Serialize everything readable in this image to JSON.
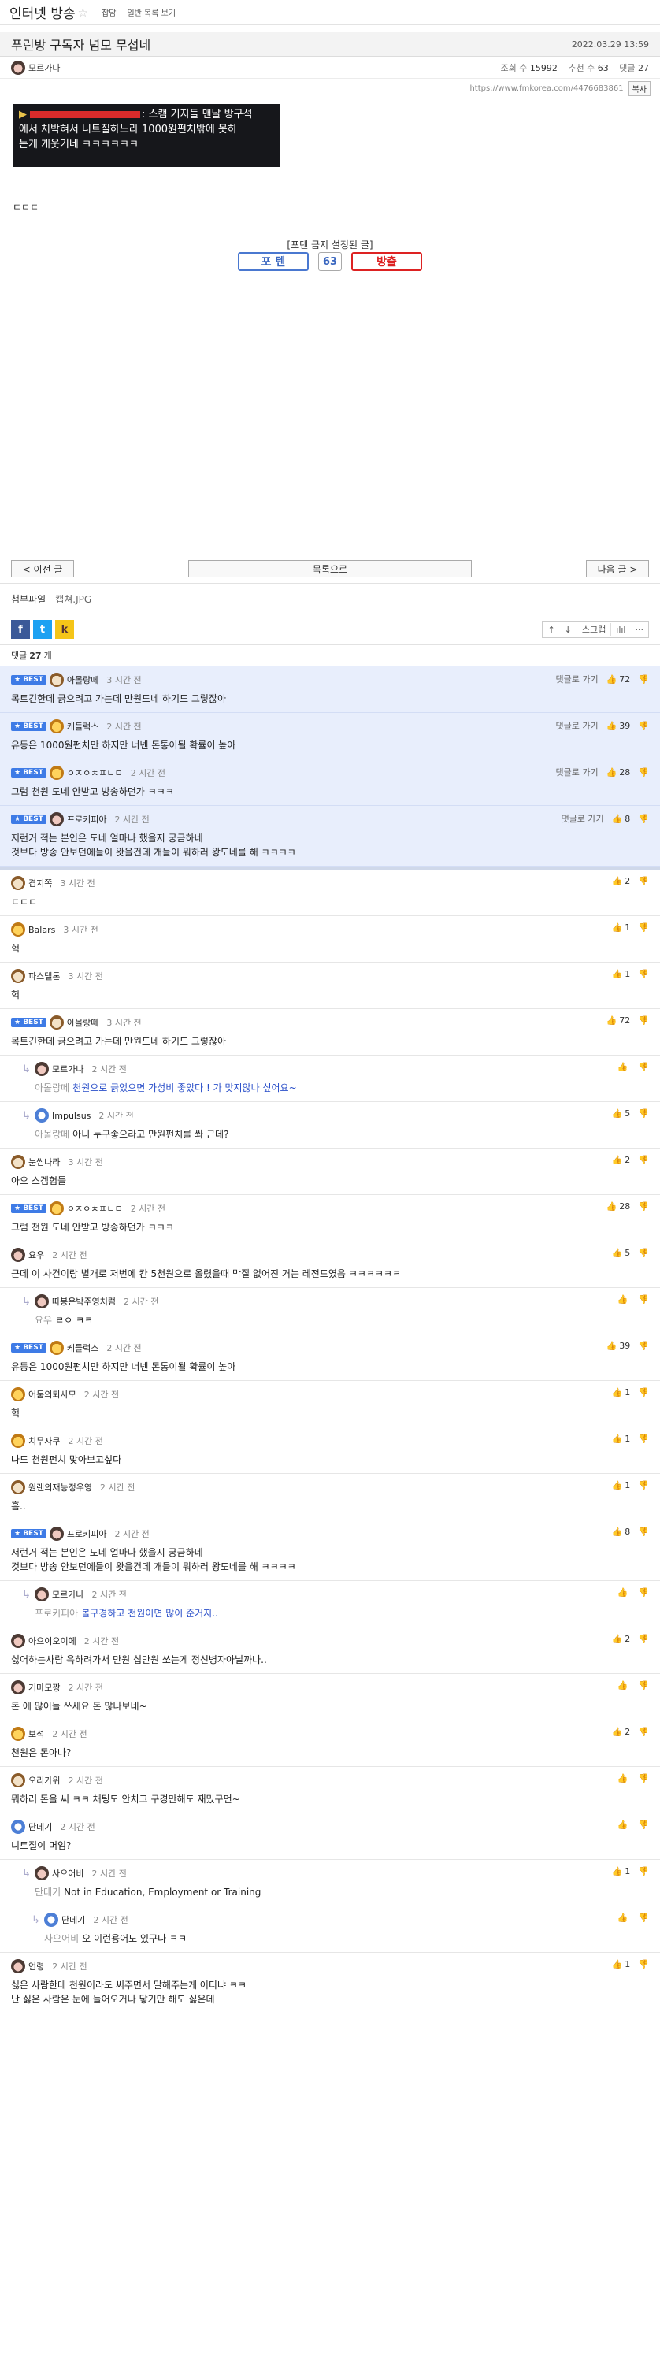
{
  "board": {
    "title": "인터넷 방송",
    "star": "☆",
    "links": [
      "잡담",
      "일반 목록 보기"
    ]
  },
  "post": {
    "title": "푸린방 구독자 념모 무섭네",
    "date": "2022.03.29 13:59",
    "author": "모르가나",
    "views_label": "조회 수",
    "views": "15992",
    "likes_label": "추천 수",
    "likes": "63",
    "comments_label": "댓글",
    "comments": "27",
    "url": "https://www.fmkorea.com/4476683861",
    "copy_label": "복사",
    "capture_line1_tail": ": 스캠 거지들 맨날 방구석",
    "capture_line2": "에서 처박혀서 니트질하느라 1000원펀치밖에 못하",
    "capture_line3": "는게 개웃기네 ㅋㅋㅋㅋㅋㅋ",
    "body": "ㄷㄷㄷ",
    "notice": "[포텐 금지 설정된 글]",
    "vote_up": "포 텐",
    "vote_count": "63",
    "vote_down": "방출"
  },
  "nav": {
    "prev": "< 이전 글",
    "list": "목록으로",
    "next": "다음 글 >"
  },
  "attach": {
    "label": "첨부파일",
    "file": "캡쳐.JPG"
  },
  "tools": {
    "fb": "f",
    "tw": "t",
    "kakao": "k",
    "up": "↑",
    "down": "↓",
    "scrap": "스크랩",
    "chart": "ılıl",
    "more": "···"
  },
  "comment_count": {
    "prefix": "댓글",
    "count": "27",
    "suffix": "개"
  },
  "ui": {
    "reply": "댓글로 가기",
    "thumb": "👍",
    "downvote": "👎",
    "best": "BEST",
    "reply_arrow": "↳"
  },
  "best_comments": [
    {
      "name": "아몰랑떼",
      "time": "3 시간 전",
      "up": "72",
      "text": "목트긴한데 긁으려고 가는데 만원도네 하기도 그렇잖아",
      "av": "dog"
    },
    {
      "name": "케들럭스",
      "time": "2 시간 전",
      "up": "39",
      "text": "유동은 1000원펀치만 하지만 너넨 돈통이될 확률이 높아",
      "av": "cat"
    },
    {
      "name": "ㅇㅈㅇㅊㅍㄴㅁ",
      "time": "2 시간 전",
      "up": "28",
      "text": "그럼 천원 도네 안받고 방송하던가 ㅋㅋㅋ",
      "av": "cat"
    },
    {
      "name": "프로키피아",
      "time": "2 시간 전",
      "up": "8",
      "text": "저런거 적는 본인은 도네 얼마나 했을지 궁금하네",
      "text2": "것보다 방송 안보던에들이 왓을건데 개들이 뭐하러 왕도네를 해 ㅋㅋㅋㅋ",
      "av": "bear"
    }
  ],
  "comments": [
    {
      "name": "겹지쪽",
      "time": "3 시간 전",
      "up": "2",
      "text": "ㄷㄷㄷ",
      "av": "dog"
    },
    {
      "name": "Balars",
      "time": "3 시간 전",
      "up": "1",
      "text": "헉",
      "av": "cat"
    },
    {
      "name": "파스텔톤",
      "time": "3 시간 전",
      "up": "1",
      "text": "헉",
      "av": "dog"
    },
    {
      "name": "아몰랑떼",
      "time": "3 시간 전",
      "up": "72",
      "text": "목트긴한데 긁으려고 가는데 만원도네 하기도 그렇잖아",
      "av": "dog",
      "best": true
    },
    {
      "name": "모르가나",
      "time": "2 시간 전",
      "up": "",
      "mention": "아몰랑떼",
      "text": "천원으로 긁었으면 가성비 좋았다 ! 가 맞지않나 싶어요~",
      "blue": true,
      "av": "bear",
      "reply": 1
    },
    {
      "name": "Impulsus",
      "time": "2 시간 전",
      "up": "5",
      "mention": "아몰랑떼",
      "text": "아니 누구좋으라고 만원펀치를 쏴 근데?",
      "av": "blue",
      "reply": 1
    },
    {
      "name": "눈썹나라",
      "time": "3 시간 전",
      "up": "2",
      "text": "아오 스겜험들",
      "av": "dog"
    },
    {
      "name": "ㅇㅈㅇㅊㅍㄴㅁ",
      "time": "2 시간 전",
      "up": "28",
      "text": "그럼 천원 도네 안받고 방송하던가 ㅋㅋㅋ",
      "av": "cat",
      "best": true
    },
    {
      "name": "요우",
      "time": "2 시간 전",
      "up": "5",
      "text": "근데 이 사건이랑 별개로 저번에 칸 5천원으로 올렸을때 막질 없어진 거는 레전드였음 ㅋㅋㅋㅋㅋㅋ",
      "av": "bear"
    },
    {
      "name": "따봉은박주영처럼",
      "time": "2 시간 전",
      "up": "",
      "mention": "요우",
      "text": "ㄹㅇ ㅋㅋ",
      "av": "bear",
      "reply": 1
    },
    {
      "name": "케들럭스",
      "time": "2 시간 전",
      "up": "39",
      "text": "유동은 1000원펀치만 하지만 너넨 돈통이될 확률이 높아",
      "av": "cat",
      "best": true
    },
    {
      "name": "어둠의퇴사모",
      "time": "2 시간 전",
      "up": "1",
      "text": "헉",
      "av": "cat"
    },
    {
      "name": "치무자쿠",
      "time": "2 시간 전",
      "up": "1",
      "text": "나도 천원펀치 맞아보고싶다",
      "av": "cat"
    },
    {
      "name": "원랜의재능정우영",
      "time": "2 시간 전",
      "up": "1",
      "text": "흠..",
      "av": "dog"
    },
    {
      "name": "프로키피아",
      "time": "2 시간 전",
      "up": "8",
      "text": "저런거 적는 본인은 도네 얼마나 했을지 궁금하네",
      "text2": "것보다 방송 안보던에들이 왓을건데 개들이 뭐하러 왕도네를 해 ㅋㅋㅋㅋ",
      "av": "bear",
      "best": true
    },
    {
      "name": "모르가나",
      "time": "2 시간 전",
      "up": "",
      "mention": "프로키피아",
      "text": "볼구경하고 천원이면 많이 준거지..",
      "blue": true,
      "av": "bear",
      "reply": 1
    },
    {
      "name": "아으이오이에",
      "time": "2 시간 전",
      "up": "2",
      "text": "싫어하는사람 욕하려가서 만원 십만원 쏘는게 정신병자아닐까나..",
      "av": "bear"
    },
    {
      "name": "거마모짱",
      "time": "2 시간 전",
      "up": "",
      "text": "돈 에 많이들 쓰세요 돈 많나보네~",
      "av": "bear"
    },
    {
      "name": "보석",
      "time": "2 시간 전",
      "up": "2",
      "text": "천원은 돈아나?",
      "av": "cat"
    },
    {
      "name": "오리가위",
      "time": "2 시간 전",
      "up": "",
      "text": "뭐하러 돈을 써 ㅋㅋ 채팅도 안치고 구경만해도 재밌구먼~",
      "av": "dog"
    },
    {
      "name": "단데기",
      "time": "2 시간 전",
      "up": "",
      "text": "니트질이 머임?",
      "av": "blue"
    },
    {
      "name": "사으어비",
      "time": "2 시간 전",
      "up": "1",
      "mention": "단데기",
      "text": "Not in Education, Employment or Training",
      "av": "bear",
      "reply": 1
    },
    {
      "name": "단데기",
      "time": "2 시간 전",
      "up": "",
      "mention": "사으어비",
      "text": "오 이런용어도 있구나 ㅋㅋ",
      "av": "blue",
      "reply": 2
    },
    {
      "name": "언령",
      "time": "2 시간 전",
      "up": "1",
      "text": "싫은 사람한테 천원이라도 써주면서 말해주는게 어디냐 ㅋㅋ",
      "text2": "난 싫은 사람은 눈에 들어오거나 닿기만 해도 싫은데",
      "av": "bear"
    }
  ]
}
